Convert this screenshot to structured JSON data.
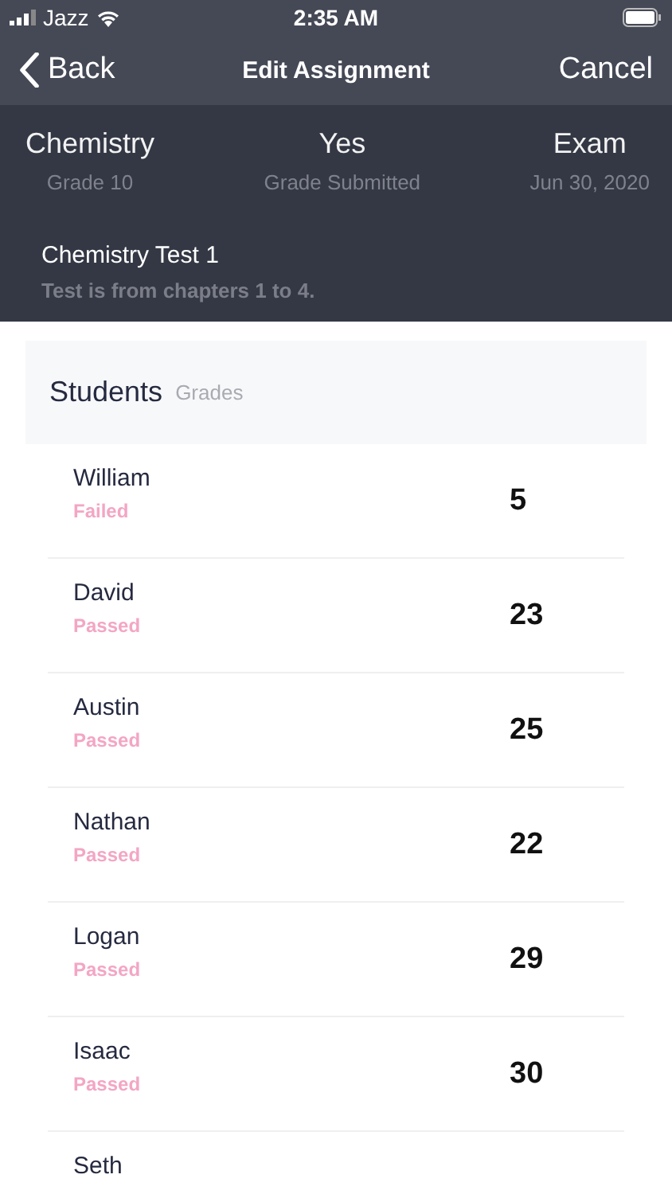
{
  "status_bar": {
    "carrier": "Jazz",
    "time": "2:35 AM"
  },
  "nav": {
    "back": "Back",
    "title": "Edit Assignment",
    "cancel": "Cancel"
  },
  "summary": [
    {
      "value": "Chemistry",
      "label": "Grade 10"
    },
    {
      "value": "Yes",
      "label": "Grade Submitted"
    },
    {
      "value": "Exam",
      "label": "Jun 30, 2020"
    }
  ],
  "assignment": {
    "title": "Chemistry Test 1",
    "description": "Test is from chapters 1 to 4."
  },
  "section": {
    "title": "Students",
    "subtitle": "Grades"
  },
  "students": [
    {
      "name": "William",
      "status": "Failed",
      "grade": "5"
    },
    {
      "name": "David",
      "status": "Passed",
      "grade": "23"
    },
    {
      "name": "Austin",
      "status": "Passed",
      "grade": "25"
    },
    {
      "name": "Nathan",
      "status": "Passed",
      "grade": "22"
    },
    {
      "name": "Logan",
      "status": "Passed",
      "grade": "29"
    },
    {
      "name": "Isaac",
      "status": "Passed",
      "grade": "30"
    },
    {
      "name": "Seth"
    }
  ]
}
